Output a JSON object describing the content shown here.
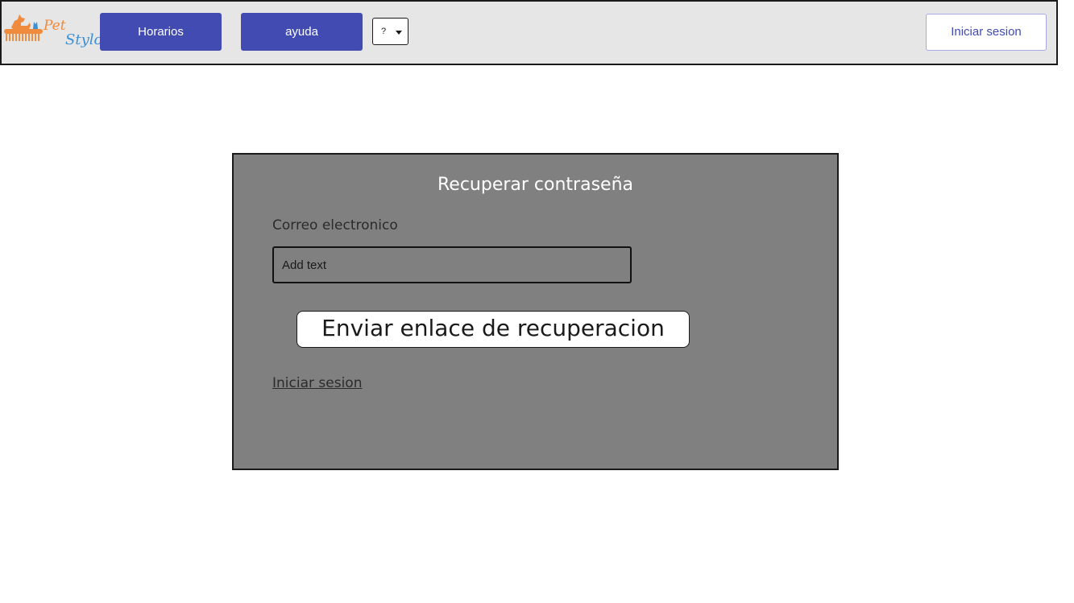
{
  "header": {
    "logo": {
      "text_pet": "Pet",
      "text_stylo": "Stylo",
      "icon": "dog-comb-logo-icon"
    },
    "nav": [
      {
        "label": "Horarios"
      },
      {
        "label": "ayuda"
      }
    ],
    "dropdown": {
      "selected": "?",
      "icon": "chevron-down-icon"
    },
    "login_button": "Iniciar sesion"
  },
  "colors": {
    "accent": "#414bb2",
    "header_bg": "#e6e6e6",
    "panel_bg": "#808080",
    "logo_orange": "#f08a3c",
    "logo_blue": "#3b8fd4"
  },
  "panel": {
    "title": "Recuperar contraseña",
    "email_label": "Correo electronico",
    "email_placeholder": "Add text",
    "email_value": "",
    "submit_label": "Enviar enlace de recuperacion",
    "signin_link": "Iniciar sesion"
  }
}
